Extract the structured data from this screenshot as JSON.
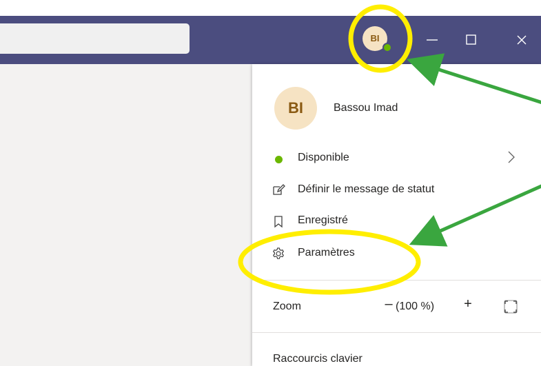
{
  "titlebar": {
    "avatar_initials": "BI"
  },
  "profile": {
    "initials": "BI",
    "name": "Bassou Imad"
  },
  "menu": {
    "status_label": "Disponible",
    "set_status_label": "Définir le message de statut",
    "saved_label": "Enregistré",
    "settings_label": "Paramètres",
    "zoom_label": "Zoom",
    "zoom_minus": "–",
    "zoom_value": "(100 %)",
    "zoom_plus": "+",
    "shortcuts_label": "Raccourcis clavier"
  },
  "colors": {
    "titlebar": "#4b4d7f",
    "avatar_bg": "#f6e3c3",
    "avatar_text": "#8a5a12",
    "presence_available": "#6bb700",
    "highlight_circle": "#ffee00",
    "arrow": "#3aa63f"
  },
  "icons": [
    "presence-available-icon",
    "edit-status-icon",
    "bookmark-icon",
    "gear-icon",
    "chevron-right-icon",
    "fit-screen-icon",
    "minimize-icon",
    "maximize-icon",
    "close-icon"
  ]
}
